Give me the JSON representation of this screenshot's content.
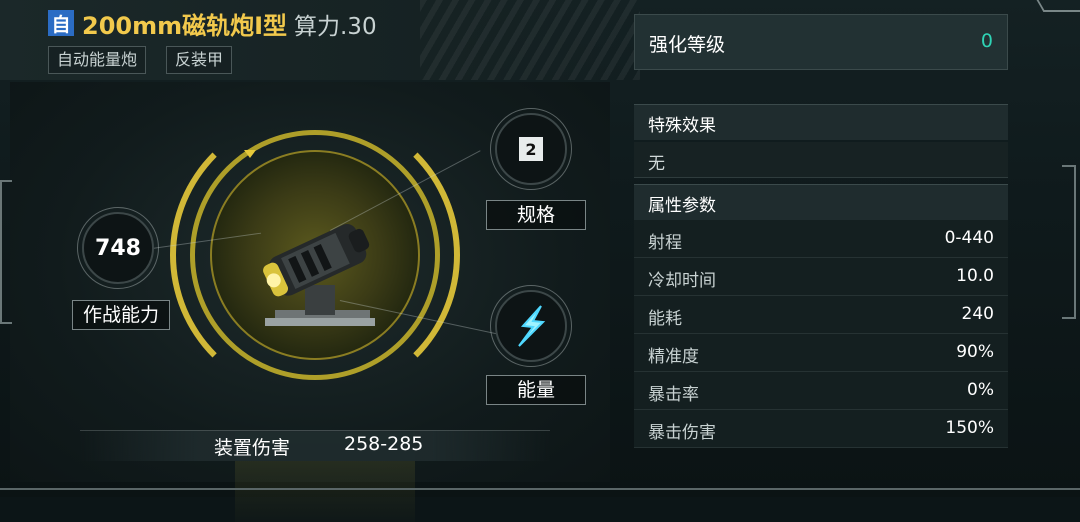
{
  "header": {
    "type_badge": "自",
    "title": "200mm磁轨炮I型",
    "power": "算力.30",
    "tags": [
      "自动能量炮",
      "反装甲"
    ]
  },
  "left": {
    "combat_value": "748",
    "combat_label": "作战能力",
    "spec_value": "2",
    "spec_label": "规格",
    "energy_label": "能量",
    "damage_label": "装置伤害",
    "damage_value": "258-285"
  },
  "right": {
    "enhance_label": "强化等级",
    "enhance_value": "0",
    "special_title": "特殊效果",
    "special_value": "无",
    "attr_title": "属性参数",
    "attributes": [
      {
        "key": "射程",
        "value": "0-440"
      },
      {
        "key": "冷却时间",
        "value": "10.0"
      },
      {
        "key": "能耗",
        "value": "240"
      },
      {
        "key": "精准度",
        "value": "90%"
      },
      {
        "key": "暴击率",
        "value": "0%"
      },
      {
        "key": "暴击伤害",
        "value": "150%"
      }
    ]
  },
  "colors": {
    "title": "#f2c94c",
    "accent_ring": "#e6c93a",
    "enhance_value": "#2fd3b5",
    "badge": "#2b6cc4"
  },
  "icons": {
    "energy": "lightning-icon",
    "weapon": "railgun-cannon-icon"
  }
}
